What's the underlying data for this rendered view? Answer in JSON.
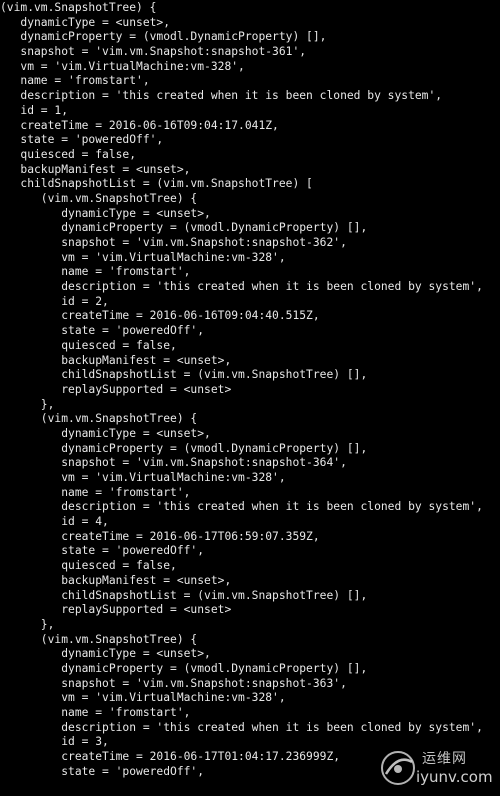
{
  "terminal": {
    "lines": [
      "(vim.vm.SnapshotTree) {",
      "   dynamicType = <unset>,",
      "   dynamicProperty = (vmodl.DynamicProperty) [],",
      "   snapshot = 'vim.vm.Snapshot:snapshot-361',",
      "   vm = 'vim.VirtualMachine:vm-328',",
      "   name = 'fromstart',",
      "   description = 'this created when it is been cloned by system',",
      "   id = 1,",
      "   createTime = 2016-06-16T09:04:17.041Z,",
      "   state = 'poweredOff',",
      "   quiesced = false,",
      "   backupManifest = <unset>,",
      "   childSnapshotList = (vim.vm.SnapshotTree) [",
      "      (vim.vm.SnapshotTree) {",
      "         dynamicType = <unset>,",
      "         dynamicProperty = (vmodl.DynamicProperty) [],",
      "         snapshot = 'vim.vm.Snapshot:snapshot-362',",
      "         vm = 'vim.VirtualMachine:vm-328',",
      "         name = 'fromstart',",
      "         description = 'this created when it is been cloned by system',",
      "         id = 2,",
      "         createTime = 2016-06-16T09:04:40.515Z,",
      "         state = 'poweredOff',",
      "         quiesced = false,",
      "         backupManifest = <unset>,",
      "         childSnapshotList = (vim.vm.SnapshotTree) [],",
      "         replaySupported = <unset>",
      "      },",
      "      (vim.vm.SnapshotTree) {",
      "         dynamicType = <unset>,",
      "         dynamicProperty = (vmodl.DynamicProperty) [],",
      "         snapshot = 'vim.vm.Snapshot:snapshot-364',",
      "         vm = 'vim.VirtualMachine:vm-328',",
      "         name = 'fromstart',",
      "         description = 'this created when it is been cloned by system',",
      "         id = 4,",
      "         createTime = 2016-06-17T06:59:07.359Z,",
      "         state = 'poweredOff',",
      "         quiesced = false,",
      "         backupManifest = <unset>,",
      "         childSnapshotList = (vim.vm.SnapshotTree) [],",
      "         replaySupported = <unset>",
      "      },",
      "      (vim.vm.SnapshotTree) {",
      "         dynamicType = <unset>,",
      "         dynamicProperty = (vmodl.DynamicProperty) [],",
      "         snapshot = 'vim.vm.Snapshot:snapshot-363',",
      "         vm = 'vim.VirtualMachine:vm-328',",
      "         name = 'fromstart',",
      "         description = 'this created when it is been cloned by system',",
      "         id = 3,",
      "         createTime = 2016-06-17T01:04:17.236999Z,",
      "         state = 'poweredOff',"
    ],
    "colors": {
      "background": "#000000",
      "foreground": "#e8e8e8"
    }
  },
  "watermark": {
    "site_name_cn": "运维网",
    "site_domain": "iyunv.com",
    "icon": "watermark-logo-icon"
  }
}
